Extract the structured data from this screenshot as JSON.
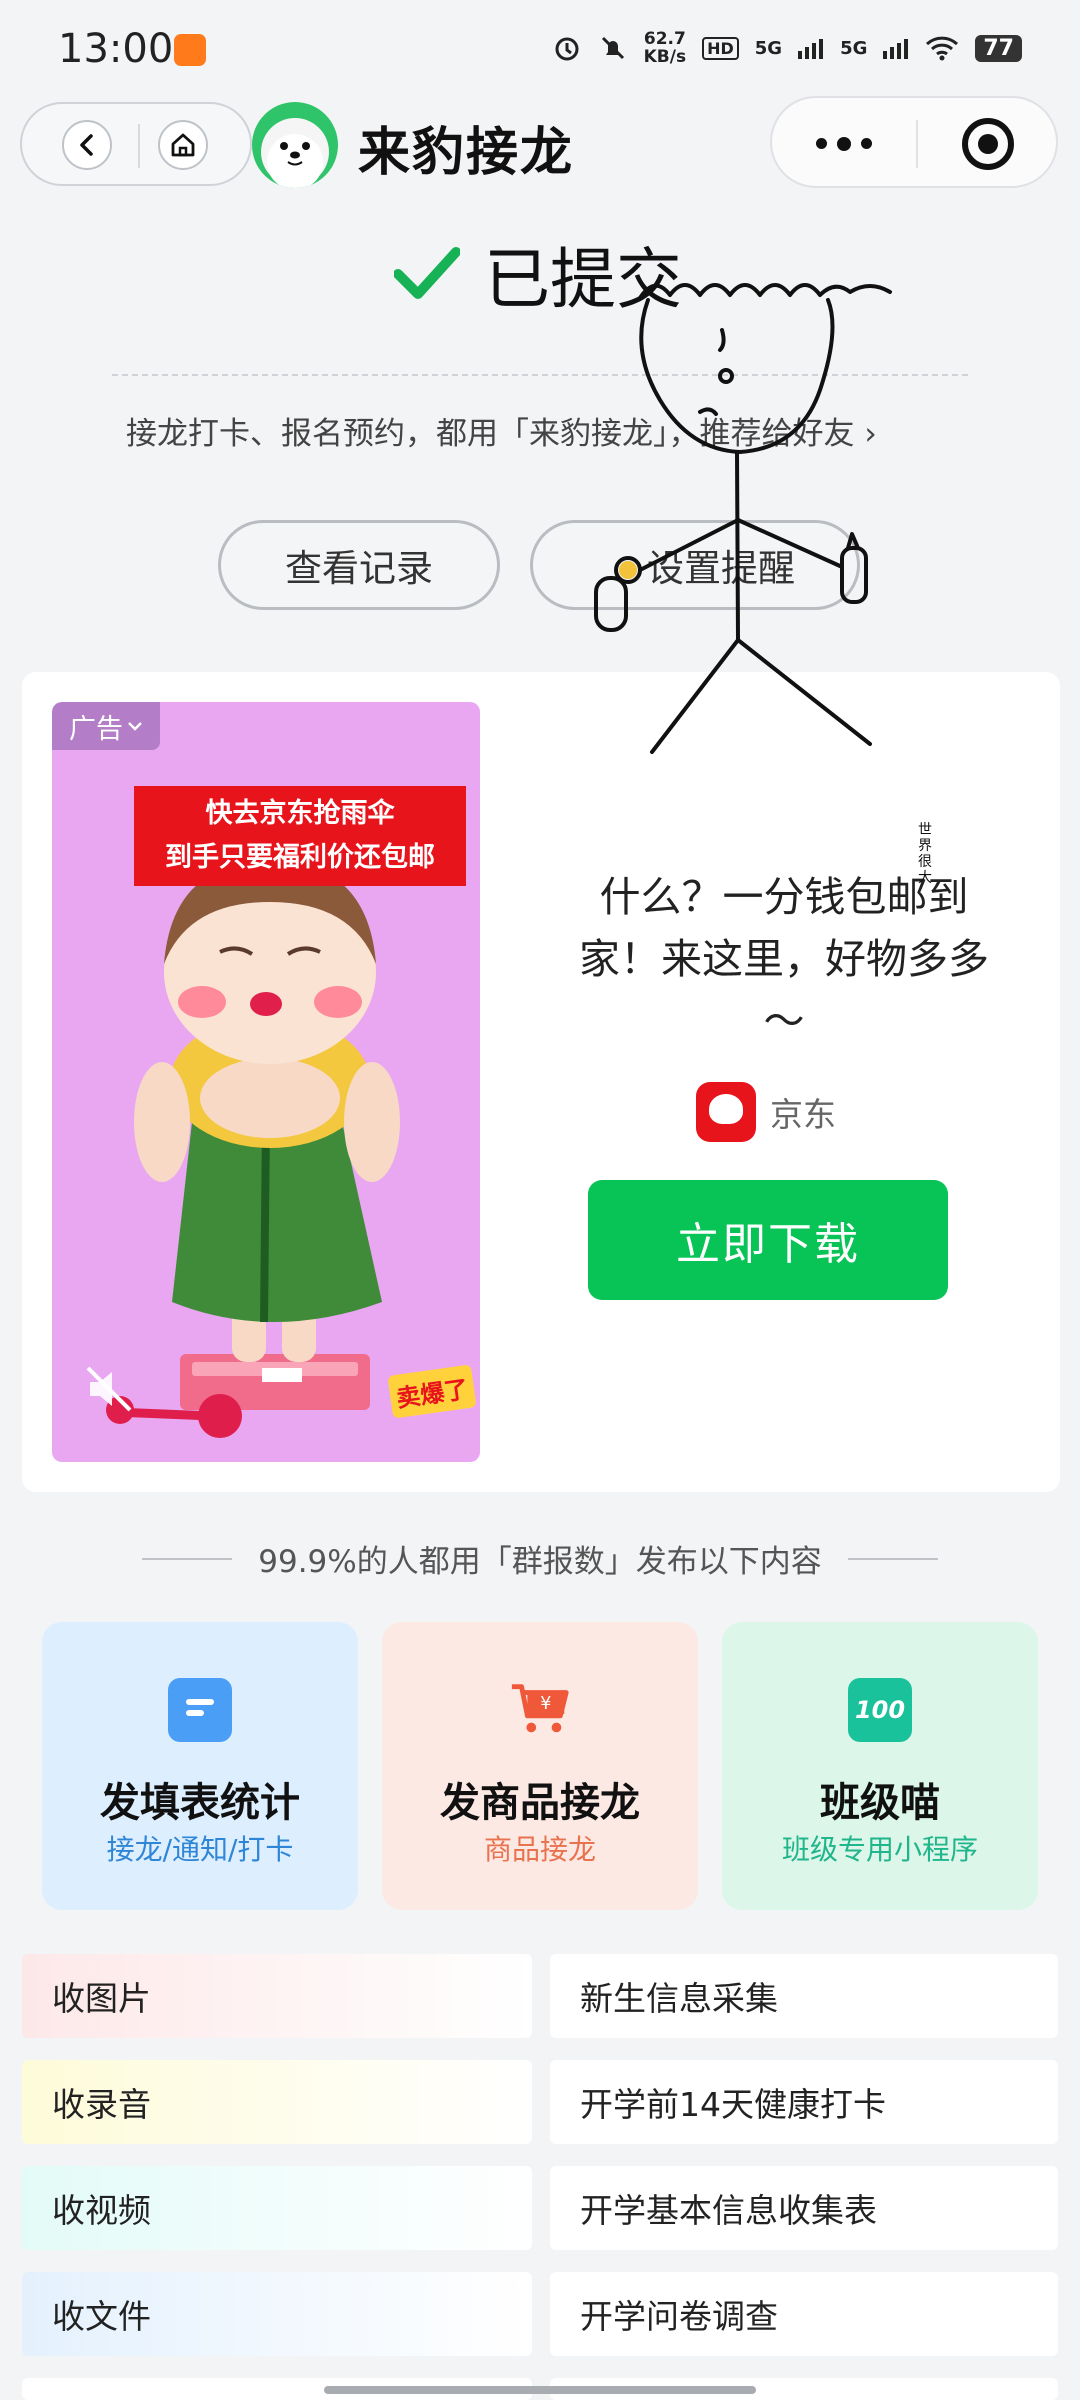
{
  "status_bar": {
    "time": "13:00",
    "speed_value": "62.7",
    "speed_unit": "KB/s",
    "hd_label": "HD",
    "signal_1": "5G",
    "signal_2": "5G",
    "battery": "77"
  },
  "nav": {
    "app_title": "来豹接龙"
  },
  "header": {
    "status_text": "已提交",
    "recommend_text": "接龙打卡、报名预约，都用「来豹接龙」，推荐给好友 ›"
  },
  "actions": {
    "view_records": "查看记录",
    "set_reminder": "设置提醒"
  },
  "ad": {
    "tag": "广告",
    "banner_line_1": "快去京东抢雨伞",
    "banner_line_2": "到手只要福利价还包邮",
    "sold_badge": "卖爆了",
    "headline": "什么？一分钱包邮到家！来这里，好物多多～",
    "brand_name": "京东",
    "cta": "立即下载"
  },
  "section": {
    "title": "99.9%的人都用「群报数」发布以下内容"
  },
  "features": [
    {
      "title": "发填表统计",
      "subtitle": "接龙/通知/打卡",
      "color": "#2f86d6"
    },
    {
      "title": "发商品接龙",
      "subtitle": "商品接龙",
      "color": "#e8734f"
    },
    {
      "title": "班级喵",
      "subtitle": "班级专用小程序",
      "color": "#21b58b",
      "icon_text": "100"
    }
  ],
  "list": {
    "left": [
      "收图片",
      "收录音",
      "收视频",
      "收文件"
    ],
    "right": [
      "新生信息采集",
      "开学前14天健康打卡",
      "开学基本信息收集表",
      "开学问卷调查"
    ]
  },
  "doodle": {
    "caption": "世界很大"
  },
  "colors": {
    "brand_green": "#08c356",
    "check_green": "#17b255",
    "jd_red": "#e8141c"
  }
}
